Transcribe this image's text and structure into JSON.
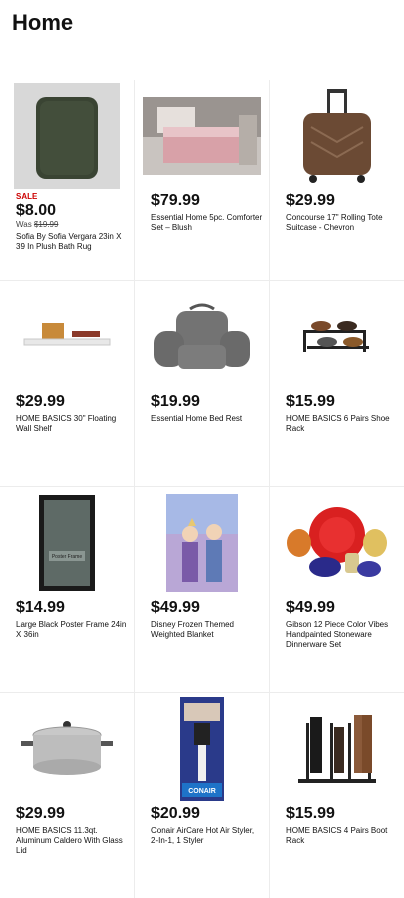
{
  "page": {
    "title": "Home"
  },
  "products": [
    {
      "sale": "SALE",
      "price": "$8.00",
      "was_label": "Was",
      "was_price": "$19.99",
      "name": "Sofia By Sofia Vergara 23in X 39 In Plush Bath Rug"
    },
    {
      "price": "$79.99",
      "name": "Essential Home 5pc. Comforter Set – Blush"
    },
    {
      "price": "$29.99",
      "name": "Concourse 17\" Rolling Tote Suitcase - Chevron"
    },
    {
      "price": "$29.99",
      "name": "HOME BASICS 30\" Floating Wall Shelf"
    },
    {
      "price": "$19.99",
      "name": "Essential Home Bed Rest"
    },
    {
      "price": "$15.99",
      "name": "HOME BASICS 6 Pairs Shoe Rack"
    },
    {
      "price": "$14.99",
      "name": "Large Black Poster Frame 24in X 36in"
    },
    {
      "price": "$49.99",
      "name": "Disney Frozen Themed Weighted Blanket"
    },
    {
      "price": "$49.99",
      "name": "Gibson 12 Piece Color Vibes Handpainted Stoneware Dinnerware Set"
    },
    {
      "price": "$29.99",
      "name": "HOME BASICS 11.3qt. Aluminum Caldero With Glass Lid"
    },
    {
      "price": "$20.99",
      "name": "Conair AirCare Hot Air Styler, 2-In-1, 1 Styler"
    },
    {
      "price": "$15.99",
      "name": "HOME BASICS 4 Pairs Boot Rack"
    }
  ],
  "image_text": {
    "frame_label": "Poster Frame",
    "conair_logo": "CONAIR"
  }
}
